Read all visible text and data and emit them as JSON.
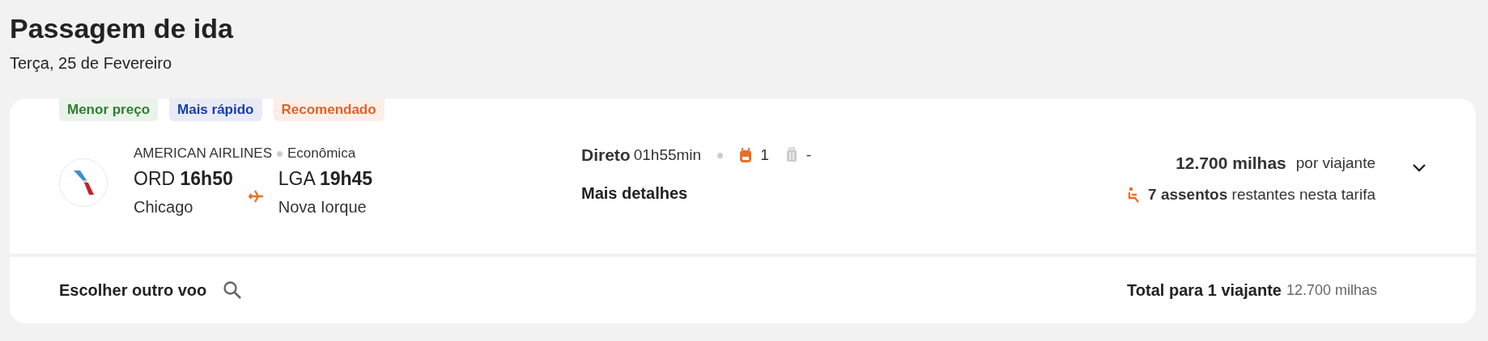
{
  "header": {
    "title": "Passagem de ida",
    "date": "Terça, 25 de Fevereiro"
  },
  "flight": {
    "tags": [
      {
        "label": "Menor preço",
        "color": "#2e7d32"
      },
      {
        "label": "Mais rápido",
        "color": "#1a3ea8"
      },
      {
        "label": "Recomendado",
        "color": "#e0622a"
      }
    ],
    "airline": "AMERICAN AIRLINES",
    "cabin": "Econômica",
    "departure": {
      "time": "ORD **16h50**",
      "city": "Chicago"
    },
    "arrival": {
      "time": "LGA **19h45**",
      "city": "Nova Iorque"
    },
    "stops": "Direto",
    "duration": "01h55min",
    "bags": [
      {
        "kind": "backpack",
        "count": "1",
        "included": true
      },
      {
        "kind": "suitcase",
        "count": "-",
        "included": false
      }
    ],
    "details_link": "Mais detalhes",
    "price": "12.700 milhas",
    "price_unit": "por viajante",
    "seats": "**7 assentos** restantes nesta tarifa",
    "expanded": false
  },
  "footer": {
    "change_flight": "Escolher outro voo",
    "total_label": "Total para 1 viajante",
    "total_value": "12.700 milhas"
  }
}
